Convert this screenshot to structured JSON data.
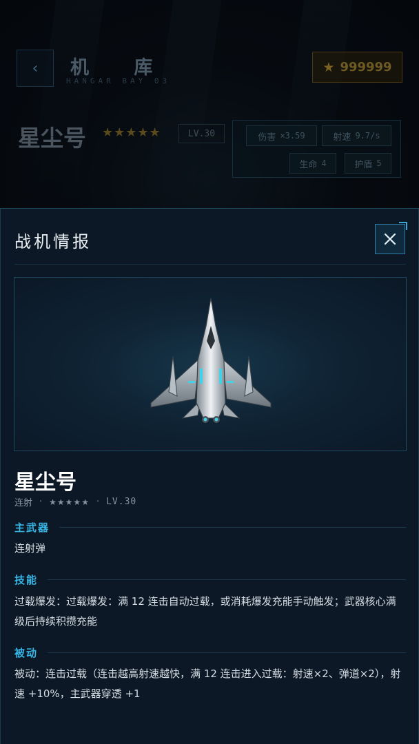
{
  "hangar": {
    "back_icon": "chevron-left-icon",
    "title": "机 库",
    "subtitle": "HANGAR BAY 03",
    "currency_icon": "star-icon",
    "currency_value": "999999",
    "ship_name": "星尘号",
    "stars": "★★★★★",
    "level": "LV.30",
    "stats": [
      {
        "label": "伤害",
        "value": "×3.59"
      },
      {
        "label": "射速",
        "value": "9.7/s"
      },
      {
        "label": "生命",
        "value": "4"
      },
      {
        "label": "护盾",
        "value": "5"
      }
    ]
  },
  "modal": {
    "title": "战机情报",
    "close_icon": "close-icon",
    "ship_icon": "fighter-jet-icon",
    "ship_name": "星尘号",
    "meta": {
      "type": "连射",
      "sep": "·",
      "stars": "★★★★★",
      "level": "LV.30"
    },
    "sections": [
      {
        "label": "主武器",
        "text": "连射弹"
      },
      {
        "label": "技能",
        "text": "过载爆发：过载爆发：满 12 连击自动过载，或消耗爆发充能手动触发；武器核心满级后持续积攒充能"
      },
      {
        "label": "被动",
        "text": "被动：连击过载（连击越高射速越快，满 12 连击进入过载：射速×2、弹道×2），射速 +10%，主武器穿透 +1"
      }
    ]
  },
  "colors": {
    "accent": "#37b6e6",
    "panel_bg": "#0c1825",
    "gold": "#7a6220"
  }
}
